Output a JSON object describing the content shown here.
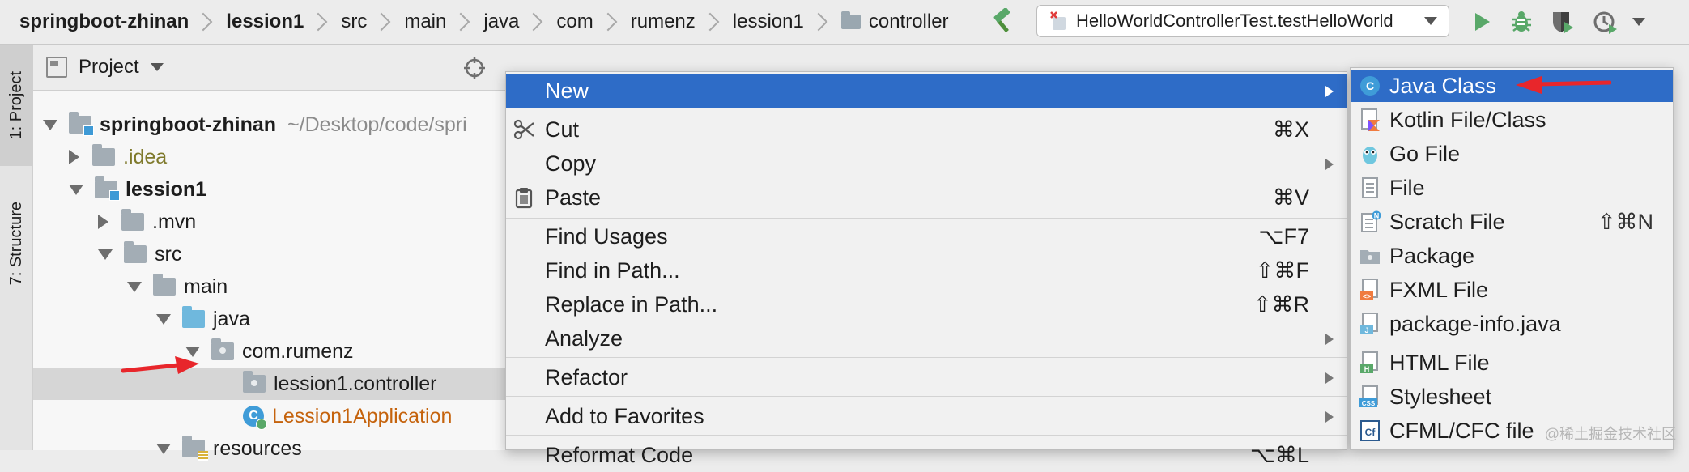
{
  "breadcrumb": {
    "items": [
      {
        "label": "springboot-zhinan",
        "bold": true
      },
      {
        "label": "lession1",
        "bold": true
      },
      {
        "label": "src"
      },
      {
        "label": "main"
      },
      {
        "label": "java"
      },
      {
        "label": "com"
      },
      {
        "label": "rumenz"
      },
      {
        "label": "lession1"
      },
      {
        "label": "controller",
        "icon": "folder-icon"
      }
    ]
  },
  "toolbar": {
    "run_config": "HelloWorldControllerTest.testHelloWorld",
    "icons": [
      "build-hammer-icon",
      "run-icon",
      "debug-icon",
      "coverage-icon",
      "profile-icon"
    ]
  },
  "tool_strip": {
    "project_tab": "1: Project",
    "structure_tab": "7: Structure"
  },
  "project_panel": {
    "title": "Project",
    "tree": [
      {
        "label": "springboot-zhinan",
        "path": "~/Desktop/code/spri",
        "bold": true
      },
      {
        "label": ".idea"
      },
      {
        "label": "lession1",
        "bold": true
      },
      {
        "label": ".mvn"
      },
      {
        "label": "src"
      },
      {
        "label": "main"
      },
      {
        "label": "java"
      },
      {
        "label": "com.rumenz"
      },
      {
        "label": "lession1.controller"
      },
      {
        "label": "Lession1Application"
      },
      {
        "label": "resources"
      }
    ]
  },
  "context_menu": {
    "items": [
      {
        "label": "New",
        "shortcut": "",
        "submenu": true
      },
      {
        "label": "Cut",
        "shortcut": "⌘X",
        "icon": "scissors-icon"
      },
      {
        "label": "Copy",
        "shortcut": "",
        "submenu": true
      },
      {
        "label": "Paste",
        "shortcut": "⌘V",
        "icon": "clipboard-icon"
      },
      {
        "label": "Find Usages",
        "shortcut": "⌥F7"
      },
      {
        "label": "Find in Path...",
        "shortcut": "⇧⌘F"
      },
      {
        "label": "Replace in Path...",
        "shortcut": "⇧⌘R"
      },
      {
        "label": "Analyze",
        "shortcut": "",
        "submenu": true
      },
      {
        "label": "Refactor",
        "shortcut": "",
        "submenu": true
      },
      {
        "label": "Add to Favorites",
        "shortcut": "",
        "submenu": true
      },
      {
        "label": "Reformat Code",
        "shortcut": "⌥⌘L"
      }
    ]
  },
  "new_submenu": {
    "items": [
      {
        "label": "Java Class",
        "shortcut": "",
        "icon": "java-class-icon"
      },
      {
        "label": "Kotlin File/Class",
        "shortcut": "",
        "icon": "kotlin-file-icon"
      },
      {
        "label": "Go File",
        "shortcut": "",
        "icon": "go-file-icon"
      },
      {
        "label": "File",
        "shortcut": "",
        "icon": "file-icon"
      },
      {
        "label": "Scratch File",
        "shortcut": "⇧⌘N",
        "icon": "scratch-file-icon"
      },
      {
        "label": "Package",
        "shortcut": "",
        "icon": "package-icon"
      },
      {
        "label": "FXML File",
        "shortcut": "",
        "icon": "fxml-file-icon"
      },
      {
        "label": "package-info.java",
        "shortcut": "",
        "icon": "package-info-icon"
      },
      {
        "label": "HTML File",
        "shortcut": "",
        "icon": "html-file-icon"
      },
      {
        "label": "Stylesheet",
        "shortcut": "",
        "icon": "stylesheet-icon"
      },
      {
        "label": "CFML/CFC file",
        "shortcut": "",
        "icon": "cfml-file-icon"
      }
    ]
  },
  "watermark": "@稀土掘金技术社区",
  "colors": {
    "highlight": "#2e6cc7",
    "annotation_arrow": "#e8262b",
    "run_green": "#59a869"
  }
}
